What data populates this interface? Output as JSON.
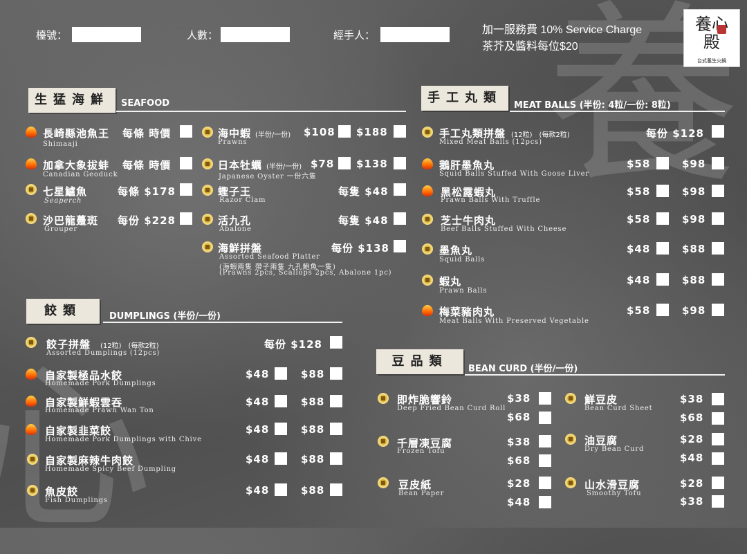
{
  "header": {
    "table_label": "檯號：",
    "people_label": "人數：",
    "handler_label": "經手人：",
    "notes": [
      "加一服務費 10% Service Charge",
      "茶芥及醬料每位$20"
    ]
  },
  "logo": {
    "main": "養心殿",
    "sub": "台式養生火鍋"
  },
  "sections": {
    "seafood": {
      "zh": "生猛海鮮",
      "en": "SEAFOOD",
      "left": [
        {
          "icon": "fire-icon",
          "zh": "長崎縣池魚王",
          "en": "Shimaaji",
          "price": "每條 時價"
        },
        {
          "icon": "fire-icon",
          "zh": "加拿大象拔蚌",
          "en": "Canadian Geoduck",
          "price": "每條 時價"
        },
        {
          "icon": "coin-icon",
          "zh": "七星鱸魚",
          "en": "Seaperch",
          "price": "每條 $178"
        },
        {
          "icon": "coin-icon",
          "zh": "沙巴龍躉斑",
          "en": "Grouper",
          "price": "每份 $228"
        }
      ],
      "right": [
        {
          "icon": "coin-icon",
          "zh": "海中蝦",
          "note": "(半份/一份)",
          "en": "Prawns",
          "half": "$108",
          "full": "$188"
        },
        {
          "icon": "coin-icon",
          "zh": "日本牡蠣",
          "note": "(半份/一份)",
          "en": "Japanese Oyster 一份六隻",
          "half": "$78",
          "full": "$138"
        },
        {
          "icon": "coin-icon",
          "zh": "蟶子王",
          "en": "Razor Clam",
          "price": "每隻 $48"
        },
        {
          "icon": "coin-icon",
          "zh": "活九孔",
          "en": "Abalone",
          "price": "每隻 $48"
        },
        {
          "icon": "coin-icon",
          "zh": "海鮮拼盤",
          "en": "Assorted Seafood Platter",
          "desc1": "(海蝦兩隻 帶子兩隻 九孔鮑魚一隻)",
          "desc2": "(Prawns 2pcs, Scallops 2pcs, Abalone 1pc)",
          "price": "每份 $138"
        }
      ]
    },
    "dumplings": {
      "zh": "餃類",
      "en": "DUMPLINGS (半份/一份)",
      "items": [
        {
          "icon": "coin-icon",
          "zh": "餃子拼盤",
          "note": "(12粒)　(每款2粒)",
          "en": "Assorted Dumplings (12pcs)",
          "price": "每份 $128"
        },
        {
          "icon": "fire-icon",
          "zh": "自家製極品水餃",
          "en": "Homemade Pork Dumplings",
          "half": "$48",
          "full": "$88"
        },
        {
          "icon": "fire-icon",
          "zh": "自家製鮮蝦雲吞",
          "en": "Homemade Prawn Wan Ton",
          "half": "$48",
          "full": "$88"
        },
        {
          "icon": "fire-icon",
          "zh": "自家製韭菜餃",
          "en": "Homemade Pork Dumplings with Chive",
          "half": "$48",
          "full": "$88"
        },
        {
          "icon": "coin-icon",
          "zh": "自家製麻辣牛肉餃",
          "en": "Homemade Spicy Beef Dumpling",
          "half": "$48",
          "full": "$88"
        },
        {
          "icon": "coin-icon",
          "zh": "魚皮餃",
          "en": "Fish Dumplings",
          "half": "$48",
          "full": "$88"
        }
      ]
    },
    "meatballs": {
      "zh": "手工丸類",
      "en": "MEAT BALLS (半份: 4粒/一份: 8粒)",
      "items": [
        {
          "icon": "coin-icon",
          "zh": "手工丸類拼盤",
          "note": "(12粒)　(每款2粒)",
          "en": "Mixed Meat Balls (12pcs)",
          "price": "每份 $128"
        },
        {
          "icon": "fire-icon",
          "zh": "鵝肝墨魚丸",
          "en": "Squid Balls Stuffed With Goose Liver",
          "half": "$58",
          "full": "$98"
        },
        {
          "icon": "fire-icon",
          "zh": "黑松露蝦丸",
          "en": "Prawn Balls With Truffle",
          "half": "$58",
          "full": "$98"
        },
        {
          "icon": "coin-icon",
          "zh": "芝士牛肉丸",
          "en": "Beef Balls Stuffed With Cheese",
          "half": "$58",
          "full": "$98"
        },
        {
          "icon": "coin-icon",
          "zh": "墨魚丸",
          "en": "Squid Balls",
          "half": "$48",
          "full": "$88"
        },
        {
          "icon": "coin-icon",
          "zh": "蝦丸",
          "en": "Prawn Balls",
          "half": "$48",
          "full": "$88"
        },
        {
          "icon": "fire-icon",
          "zh": "梅菜豬肉丸",
          "en": "Meat Balls With Preserved Vegetable",
          "half": "$58",
          "full": "$98"
        }
      ]
    },
    "beancurd": {
      "zh": "豆品類",
      "en": "BEAN CURD (半份/一份)",
      "left": [
        {
          "icon": "coin-icon",
          "zh": "即炸脆響鈴",
          "en": "Deep Fried Bean Curd Roll",
          "half": "$38",
          "full": "$68"
        },
        {
          "icon": "coin-icon",
          "zh": "千層凍豆腐",
          "en": "Frozen Tofu",
          "half": "$38",
          "full": "$68"
        },
        {
          "icon": "coin-icon",
          "zh": "豆皮紙",
          "en": "Bean Paper",
          "half": "$28",
          "full": "$48"
        }
      ],
      "right": [
        {
          "icon": "coin-icon",
          "zh": "鮮豆皮",
          "en": "Bean Curd Sheet",
          "half": "$38",
          "full": "$68"
        },
        {
          "icon": "coin-icon",
          "zh": "油豆腐",
          "en": "Dry Bean Curd",
          "half": "$28",
          "full": "$48"
        },
        {
          "icon": "coin-icon",
          "zh": "山水滑豆腐",
          "en": "Smoothy Tofu",
          "half": "$28",
          "full": "$38"
        }
      ]
    }
  }
}
